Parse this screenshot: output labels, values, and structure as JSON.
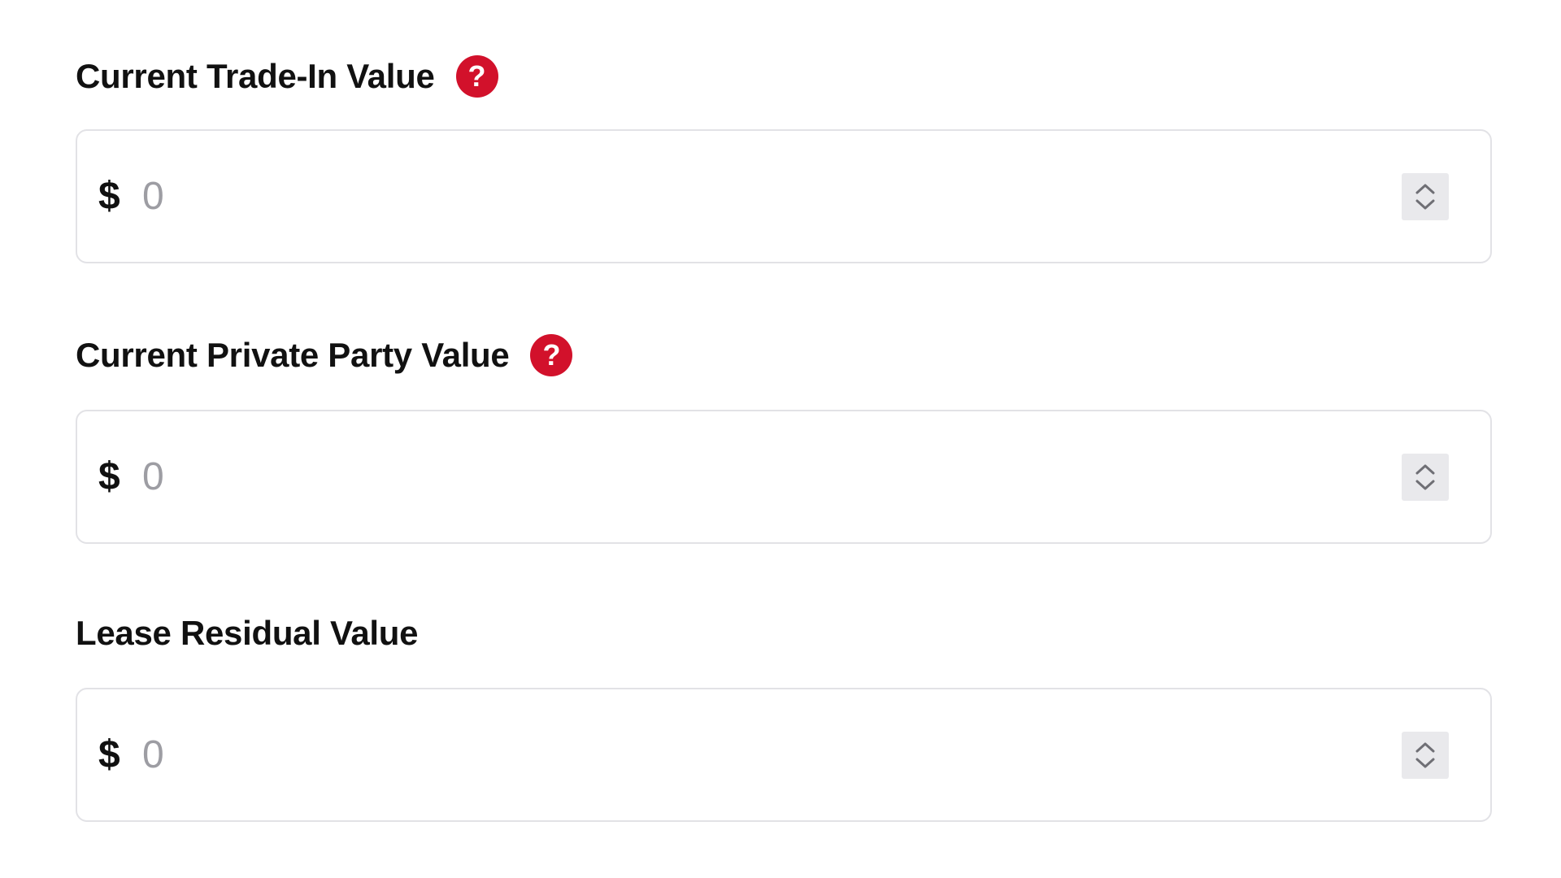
{
  "fields": [
    {
      "label": "Current Trade-In Value",
      "has_help": true,
      "currency_symbol": "$",
      "placeholder": "0",
      "value": ""
    },
    {
      "label": "Current Private Party Value",
      "has_help": true,
      "currency_symbol": "$",
      "placeholder": "0",
      "value": ""
    },
    {
      "label": "Lease Residual Value",
      "has_help": false,
      "currency_symbol": "$",
      "placeholder": "0",
      "value": ""
    }
  ],
  "help_icon_glyph": "?",
  "icons": {
    "help": "question-circle-icon",
    "stepper_up": "chevron-up-icon",
    "stepper_down": "chevron-down-icon"
  },
  "colors": {
    "accent": "#d2112b",
    "border": "#e2e2e6",
    "placeholder": "#9d9da3",
    "stepper_bg": "#e9e9ec"
  }
}
